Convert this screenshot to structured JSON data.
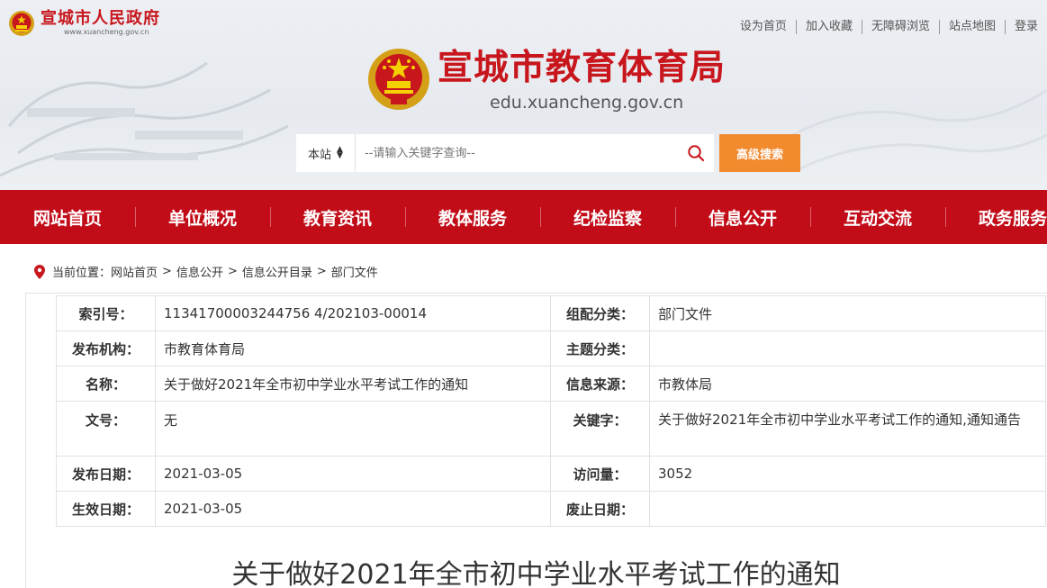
{
  "gov": {
    "name": "宣城市人民政府",
    "domain": "www.xuancheng.gov.cn"
  },
  "toplinks": [
    "设为首页",
    "加入收藏",
    "无障碍浏览",
    "站点地图",
    "登录"
  ],
  "brand": {
    "title": "宣城市教育体育局",
    "url": "edu.xuancheng.gov.cn"
  },
  "search": {
    "scope": "本站",
    "placeholder": "--请输入关键字查询--",
    "advanced": "高级搜索"
  },
  "nav": [
    "网站首页",
    "单位概况",
    "教育资讯",
    "教体服务",
    "纪检监察",
    "信息公开",
    "互动交流",
    "政务服务"
  ],
  "breadcrumb": {
    "label": "当前位置：",
    "items": [
      "网站首页",
      "信息公开",
      "信息公开目录",
      "部门文件"
    ],
    "sep": ">"
  },
  "meta": {
    "index_label": "索引号：",
    "index_value": "11341700003244756 4/202103-00014",
    "category_label": "组配分类：",
    "category_value": "部门文件",
    "publisher_label": "发布机构：",
    "publisher_value": "市教育体育局",
    "topic_label": "主题分类：",
    "topic_value": "",
    "name_label": "名称：",
    "name_value": "关于做好2021年全市初中学业水平考试工作的通知",
    "source_label": "信息来源：",
    "source_value": "市教体局",
    "docno_label": "文号：",
    "docno_value": "无",
    "keywords_label": "关键字：",
    "keywords_value": "关于做好2021年全市初中学业水平考试工作的通知,通知通告",
    "pubdate_label": "发布日期：",
    "pubdate_value": "2021-03-05",
    "visits_label": "访问量：",
    "visits_value": "3052",
    "effdate_label": "生效日期：",
    "effdate_value": "2021-03-05",
    "expdate_label": "废止日期：",
    "expdate_value": ""
  },
  "document": {
    "title": "关于做好2021年全市初中学业水平考试工作的通知"
  },
  "colors": {
    "brand_red": "#c20d19",
    "title_red": "#c8161d",
    "search_orange": "#f28a2e"
  },
  "icons": [
    "national-emblem-icon",
    "search-icon",
    "location-pin-icon",
    "sort-arrows-icon"
  ]
}
